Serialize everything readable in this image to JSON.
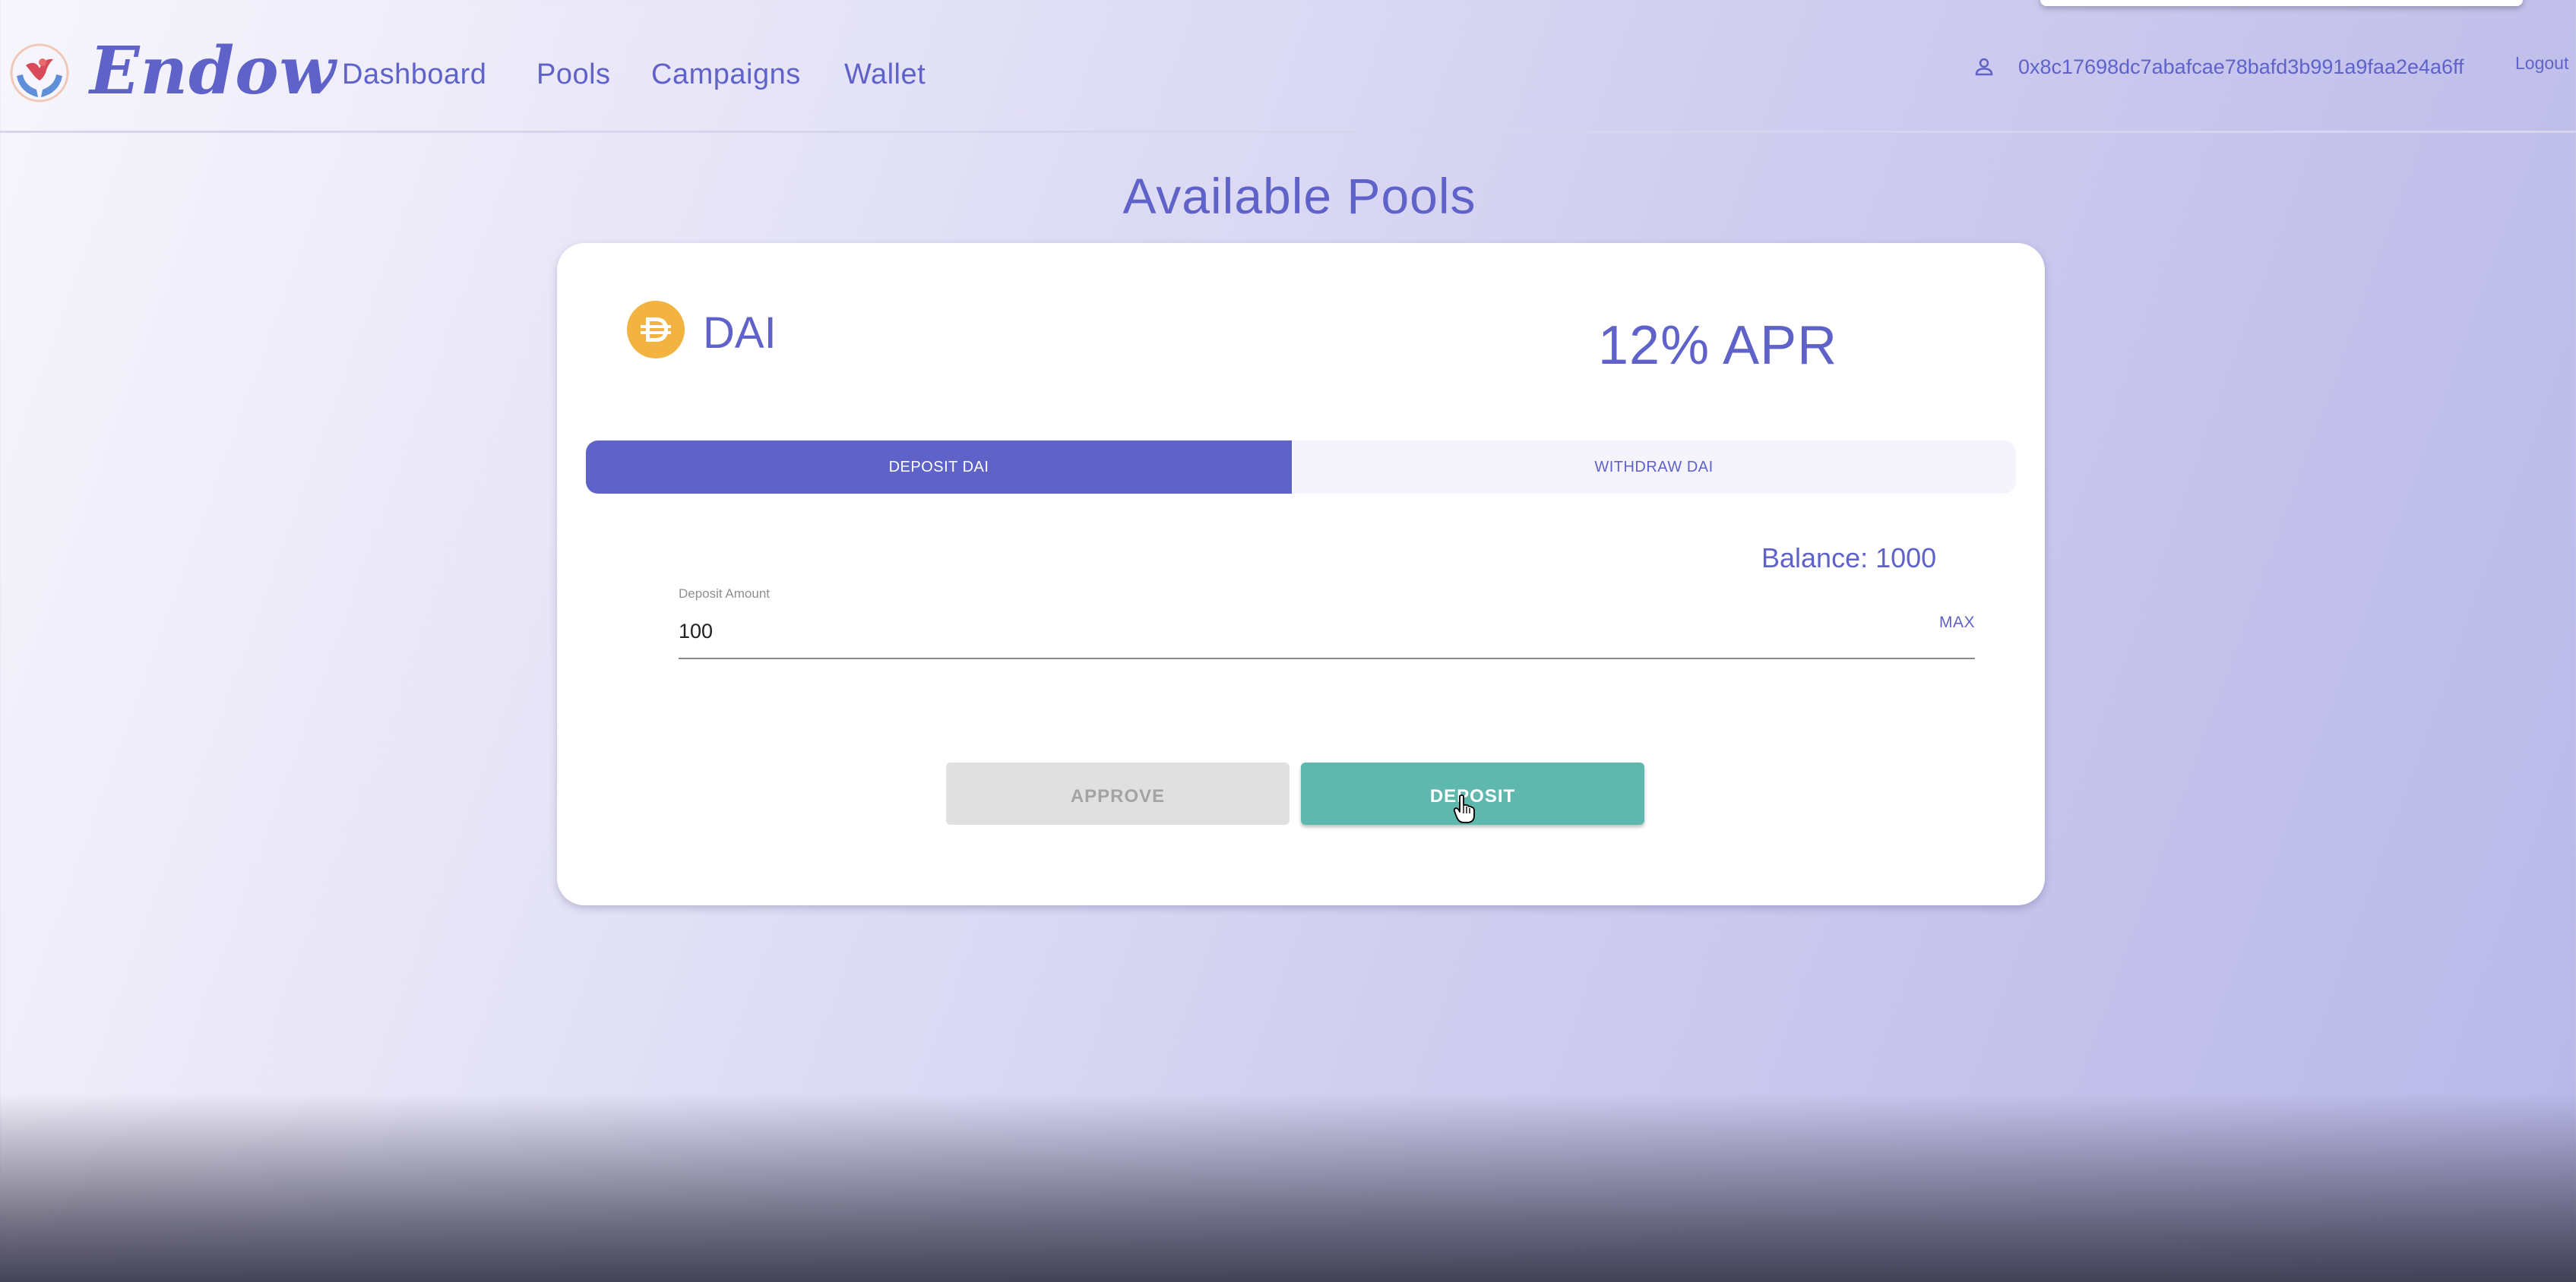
{
  "app": {
    "brand": "Endow"
  },
  "header": {
    "nav": [
      {
        "label": "Dashboard"
      },
      {
        "label": "Pools"
      },
      {
        "label": "Campaigns"
      },
      {
        "label": "Wallet"
      }
    ],
    "account_address": "0x8c17698dc7abafcae78bafd3b991a9faa2e4a6ff",
    "logout_label": "Logout"
  },
  "page": {
    "title": "Available Pools"
  },
  "pool": {
    "coin_name": "DAI",
    "coin_icon": "dai-coin-icon",
    "apr": "12% APR",
    "tabs": [
      {
        "label": "DEPOSIT DAI",
        "active": true
      },
      {
        "label": "WITHDRAW DAI",
        "active": false
      }
    ],
    "balance": "Balance: 1000",
    "deposit_field": {
      "label": "Deposit Amount",
      "value": "100",
      "max_label": "MAX"
    },
    "approve_label": "APPROVE",
    "deposit_label": "DEPOSIT"
  },
  "colors": {
    "accent": "#5f62c9",
    "deposit_button": "#5fb8ae",
    "approve_button_disabled": "#e0e0e0",
    "coin": "#f2b341"
  }
}
